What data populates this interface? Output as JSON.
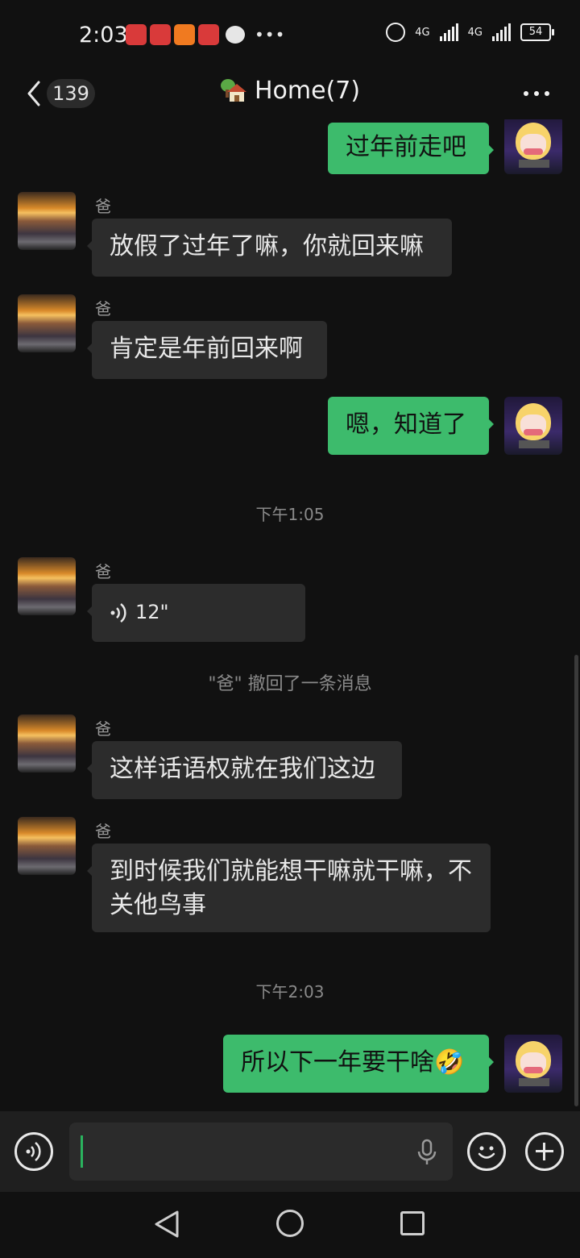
{
  "status_bar": {
    "time": "2:03",
    "network_1": "4G",
    "network_2": "4G",
    "battery": "54"
  },
  "header": {
    "unread_count": "139",
    "title": "Home(7)"
  },
  "messages": [
    {
      "type": "out",
      "text": "过年前走吧"
    },
    {
      "type": "in",
      "sender": "爸",
      "text": "放假了过年了嘛，你就回来嘛"
    },
    {
      "type": "in",
      "sender": "爸",
      "text": "肯定是年前回来啊"
    },
    {
      "type": "out",
      "text": "嗯，知道了"
    },
    {
      "type": "time",
      "text": "下午1:05"
    },
    {
      "type": "in-voice",
      "sender": "爸",
      "duration": "12\""
    },
    {
      "type": "system",
      "text": "\"爸\" 撤回了一条消息"
    },
    {
      "type": "in",
      "sender": "爸",
      "text": "这样话语权就在我们这边"
    },
    {
      "type": "in",
      "sender": "爸",
      "text": "到时候我们就能想干嘛就干嘛，不关他鸟事"
    },
    {
      "type": "time",
      "text": "下午2:03"
    },
    {
      "type": "out",
      "text": "所以下一年要干啥🤣"
    }
  ],
  "colors": {
    "background": "#111111",
    "bubble_in": "#2c2c2c",
    "bubble_out": "#3dbb6c",
    "caret": "#2ab35e"
  }
}
